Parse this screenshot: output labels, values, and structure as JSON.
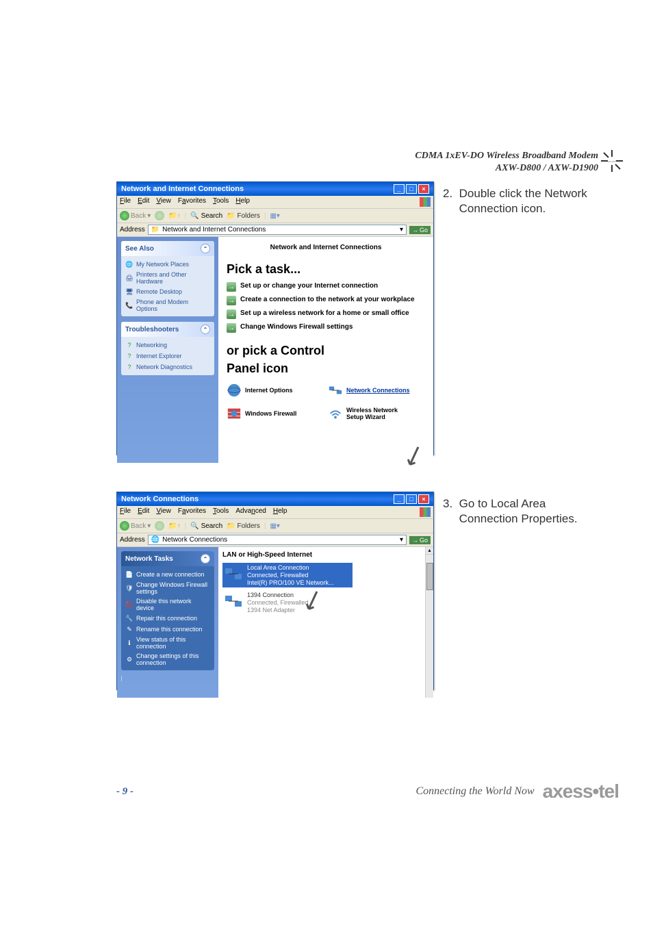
{
  "header": {
    "line1": "CDMA 1xEV-DO Wireless Broadband Modem",
    "line2": "AXW-D800 / AXW-D1900"
  },
  "steps": {
    "step2_num": "2.",
    "step2_text1": "Double click the Network",
    "step2_text2": "Connection icon.",
    "step3_num": "3.",
    "step3_text1": "Go to Local Area",
    "step3_text2": "Connection Properties."
  },
  "window1": {
    "title": "Network and Internet Connections",
    "menu": {
      "file": "File",
      "edit": "Edit",
      "view": "View",
      "favorites": "Favorites",
      "tools": "Tools",
      "help": "Help"
    },
    "toolbar": {
      "back": "Back",
      "search": "Search",
      "folders": "Folders"
    },
    "address_label": "Address",
    "address_value": "Network and Internet Connections",
    "go": "Go",
    "sidebar": {
      "see_also": "See Also",
      "items1": {
        "places": "My Network Places",
        "printers": "Printers and Other Hardware",
        "remote": "Remote Desktop",
        "phone": "Phone and Modem Options"
      },
      "trouble": "Troubleshooters",
      "items2": {
        "networking": "Networking",
        "ie": "Internet Explorer",
        "diag": "Network Diagnostics"
      }
    },
    "main": {
      "heading": "Network and Internet Connections",
      "pick_task": "Pick a task...",
      "tasks": {
        "t1": "Set up or change your Internet connection",
        "t2": "Create a connection to the network at your workplace",
        "t3": "Set up a wireless network for a home or small office",
        "t4": "Change Windows Firewall settings"
      },
      "or_pick1": "or pick a Control",
      "or_pick2": "Panel icon",
      "icons": {
        "internet_options": "Internet Options",
        "network_conn": "Network Connections",
        "firewall": "Windows Firewall",
        "wireless": "Wireless Network Setup Wizard"
      }
    }
  },
  "window2": {
    "title": "Network Connections",
    "menu": {
      "file": "File",
      "edit": "Edit",
      "view": "View",
      "favorites": "Favorites",
      "tools": "Tools",
      "advanced": "Advanced",
      "help": "Help"
    },
    "toolbar": {
      "back": "Back",
      "search": "Search",
      "folders": "Folders"
    },
    "address_label": "Address",
    "address_value": "Network Connections",
    "go": "Go",
    "sidebar": {
      "net_tasks": "Network Tasks",
      "items": {
        "create": "Create a new connection",
        "firewall": "Change Windows Firewall settings",
        "disable": "Disable this network device",
        "repair": "Repair this connection",
        "rename": "Rename this connection",
        "status": "View status of this connection",
        "change": "Change settings of this connection"
      }
    },
    "main": {
      "lan_hdr": "LAN or High-Speed Internet",
      "conn1": {
        "name": "Local Area Connection",
        "status": "Connected, Firewalled",
        "device": "Intel(R) PRO/100 VE Network..."
      },
      "conn2": {
        "name": "1394 Connection",
        "status": "Connected, Firewalled",
        "device": "1394 Net Adapter"
      }
    }
  },
  "footer": {
    "page": "- 9 -",
    "tagline": "Connecting the World Now",
    "brand": "axess•tel"
  }
}
